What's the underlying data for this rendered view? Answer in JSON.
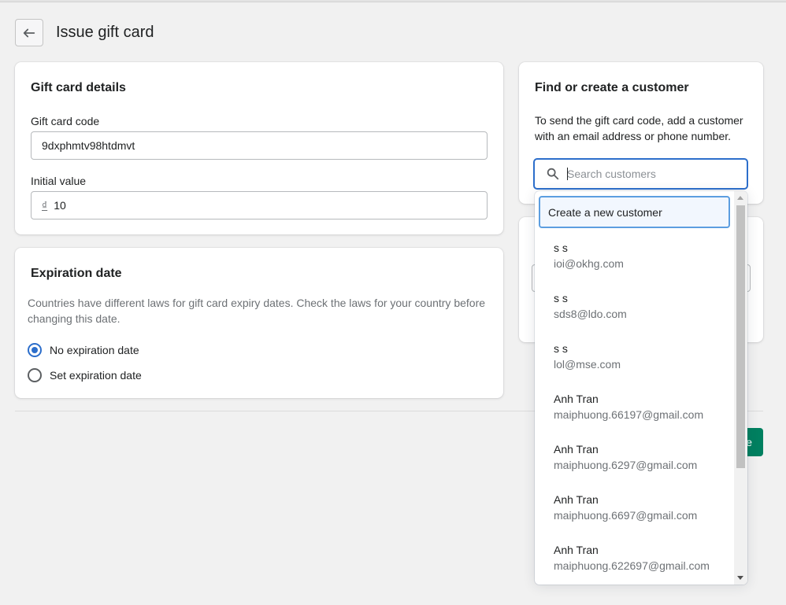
{
  "header": {
    "title": "Issue gift card"
  },
  "gift_card_details": {
    "title": "Gift card details",
    "code_label": "Gift card code",
    "code_value": "9dxphmtv98htdmvt",
    "initial_value_label": "Initial value",
    "currency_symbol": "₫",
    "initial_value": "10"
  },
  "expiration": {
    "title": "Expiration date",
    "help": "Countries have different laws for gift card expiry dates. Check the laws for your country before changing this date.",
    "options": [
      {
        "label": "No expiration date",
        "checked": true
      },
      {
        "label": "Set expiration date",
        "checked": false
      }
    ]
  },
  "customer": {
    "title": "Find or create a customer",
    "help": "To send the gift card code, add a customer with an email address or phone number.",
    "search_placeholder": "Search customers",
    "create_new_label": "Create a new customer",
    "results": [
      {
        "name": "s s",
        "email": "ioi@okhg.com"
      },
      {
        "name": "s s",
        "email": "sds8@ldo.com"
      },
      {
        "name": "s s",
        "email": "lol@mse.com"
      },
      {
        "name": "Anh Tran",
        "email": "maiphuong.66197@gmail.com"
      },
      {
        "name": "Anh Tran",
        "email": "maiphuong.6297@gmail.com"
      },
      {
        "name": "Anh Tran",
        "email": "maiphuong.6697@gmail.com"
      },
      {
        "name": "Anh Tran",
        "email": "maiphuong.622697@gmail.com"
      }
    ]
  },
  "footer": {
    "save_label_partial": "e"
  },
  "colors": {
    "accent": "#2c6ecb",
    "primary_button": "#008060"
  }
}
